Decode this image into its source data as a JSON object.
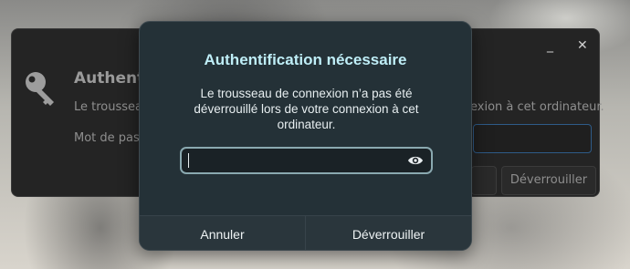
{
  "back_window": {
    "minimize_glyph": "_",
    "close_glyph": "✕",
    "title": "Authentif",
    "desc_left": "Le trousseau",
    "desc_right": "exion à cet ordinateur.",
    "password_label": "Mot de pass",
    "unlock_label": "Déverrouiller",
    "icon": "key-icon"
  },
  "dialog": {
    "title": "Authentification nécessaire",
    "message": "Le trousseau de connexion n’a pas été déverrouillé lors de votre connexion à cet ordinateur.",
    "password_value": "",
    "eye_icon": "eye-icon",
    "cancel_label": "Annuler",
    "unlock_label": "Déverrouiller"
  },
  "colors": {
    "dialog_bg": "#243137",
    "title_color": "#bfeef7",
    "field_border": "#8aa9b0"
  }
}
